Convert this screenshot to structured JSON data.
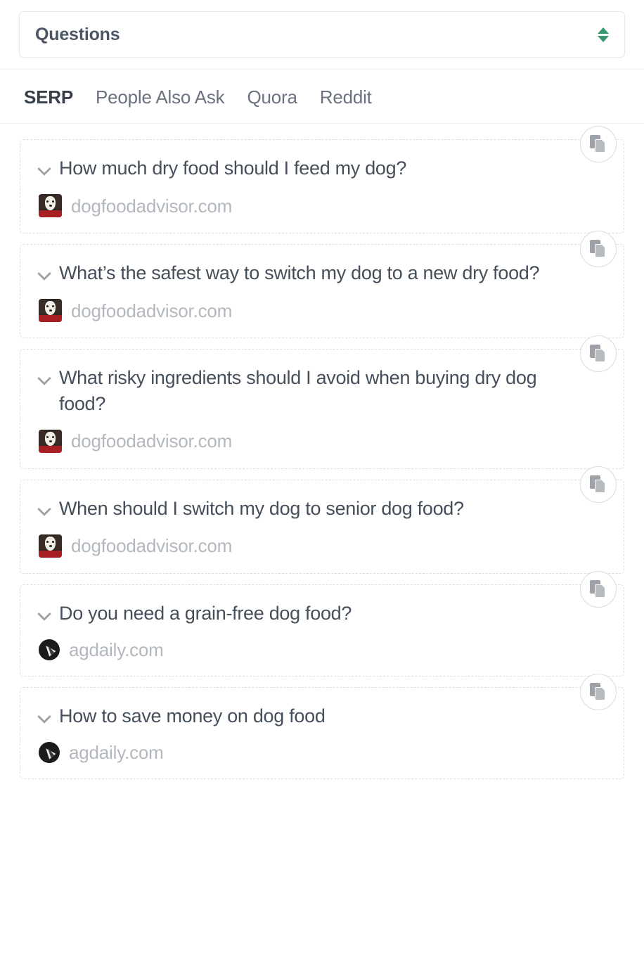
{
  "selector": {
    "label": "Questions",
    "icon": "sort-updown-icon",
    "accent_color": "#3a9671"
  },
  "tabs": [
    {
      "label": "SERP",
      "active": true
    },
    {
      "label": "People Also Ask",
      "active": false
    },
    {
      "label": "Quora",
      "active": false
    },
    {
      "label": "Reddit",
      "active": false
    }
  ],
  "results": [
    {
      "question": "How much dry food should I feed my dog?",
      "source": "dogfoodadvisor.com",
      "favicon": "dog-photo-favicon",
      "copy_label": "copy"
    },
    {
      "question": "What’s the safest way to switch my dog to a new dry food?",
      "source": "dogfoodadvisor.com",
      "favicon": "dog-photo-favicon",
      "copy_label": "copy"
    },
    {
      "question": "What risky ingredients should I avoid when buying dry dog food?",
      "source": "dogfoodadvisor.com",
      "favicon": "dog-photo-favicon",
      "copy_label": "copy"
    },
    {
      "question": "When should I switch my dog to senior dog food?",
      "source": "dogfoodadvisor.com",
      "favicon": "dog-photo-favicon",
      "copy_label": "copy"
    },
    {
      "question": "Do you need a grain-free dog food?",
      "source": "agdaily.com",
      "favicon": "compass-favicon",
      "copy_label": "copy"
    },
    {
      "question": "How to save money on dog food",
      "source": "agdaily.com",
      "favicon": "compass-favicon",
      "copy_label": "copy"
    }
  ],
  "colors": {
    "question_text": "#454f5b",
    "source_text": "#b3b8be",
    "tab_active": "#363f4a",
    "tab_inactive": "#6b7280",
    "card_border": "#dcdee1"
  }
}
